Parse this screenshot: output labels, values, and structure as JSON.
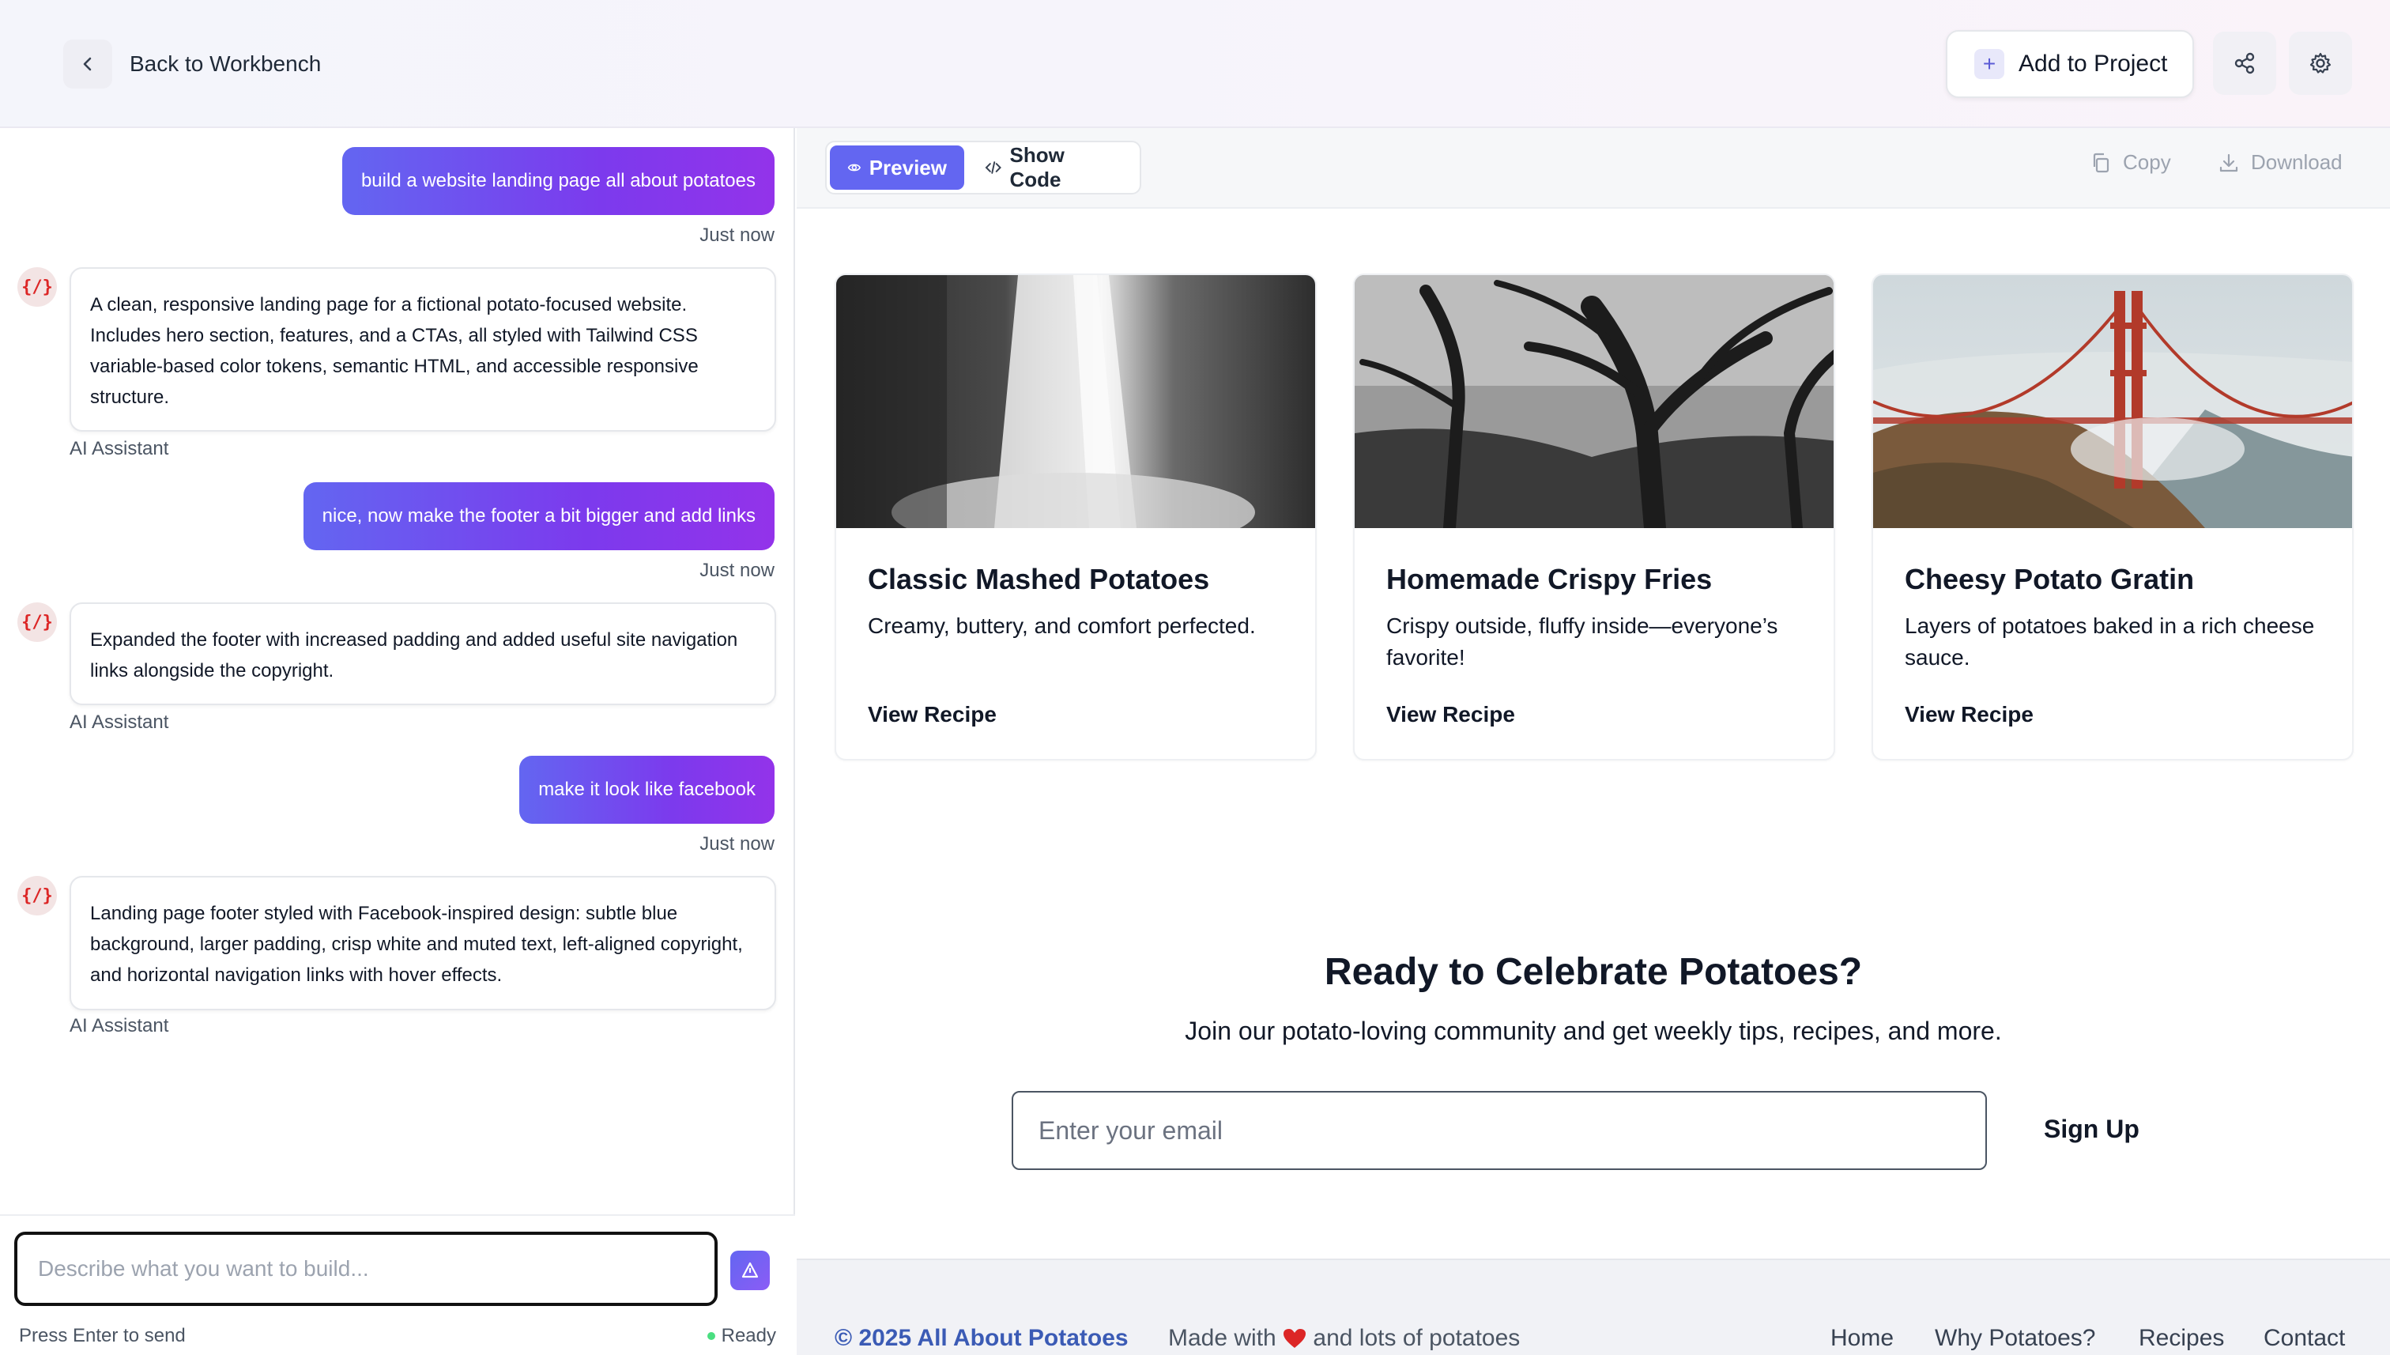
{
  "header": {
    "back_label": "Back to Workbench",
    "add_project_label": "Add to Project",
    "icons": [
      "chevron-left-icon",
      "plus-icon",
      "share-icon",
      "gear-icon"
    ]
  },
  "chat": {
    "messages": [
      {
        "role": "user",
        "text": "build a website landing page all about potatoes",
        "time": "Just now"
      },
      {
        "role": "assistant",
        "avatar": "{/}",
        "text": "A clean, responsive landing page for a fictional potato-focused website. Includes hero section, features, and a CTAs, all styled with Tailwind CSS variable-based color tokens, semantic HTML, and accessible responsive structure.",
        "name": "AI Assistant"
      },
      {
        "role": "user",
        "text": "nice, now make the footer a bit bigger and add links",
        "time": "Just now"
      },
      {
        "role": "assistant",
        "avatar": "{/}",
        "text": "Expanded the footer with increased padding and added useful site navigation links alongside the copyright.",
        "name": "AI Assistant"
      },
      {
        "role": "user",
        "text": "make it look like facebook",
        "time": "Just now"
      },
      {
        "role": "assistant",
        "avatar": "{/}",
        "text": "Landing page footer styled with Facebook-inspired design: subtle blue background, larger padding, crisp white and muted text, left-aligned copyright, and horizontal navigation links with hover effects.",
        "name": "AI Assistant"
      }
    ],
    "input_placeholder": "Describe what you want to build...",
    "hint": "Press Enter to send",
    "status": "Ready",
    "status_color": "#4ade80"
  },
  "toolbar": {
    "preview_label": "Preview",
    "code_label": "Show Code",
    "copy_label": "Copy",
    "download_label": "Download",
    "accent": "#6366f1"
  },
  "preview": {
    "cards": [
      {
        "title": "Classic Mashed Potatoes",
        "desc": "Creamy, buttery, and comfort perfected.",
        "link": "View Recipe",
        "image": "waterfall"
      },
      {
        "title": "Homemade Crispy Fries",
        "desc": "Crispy outside, fluffy inside—everyone’s favorite!",
        "link": "View Recipe",
        "image": "forest"
      },
      {
        "title": "Cheesy Potato Gratin",
        "desc": "Layers of potatoes baked in a rich cheese sauce.",
        "link": "View Recipe",
        "image": "bridge"
      }
    ],
    "cta_title": "Ready to Celebrate Potatoes?",
    "cta_sub": "Join our potato-loving community and get weekly tips, recipes, and more.",
    "email_placeholder": "Enter your email",
    "signup_label": "Sign Up",
    "footer": {
      "copyright": "© 2025 All About Potatoes",
      "made_prefix": "Made with",
      "made_suffix": "and lots of potatoes",
      "links": [
        "Home",
        "Why Potatoes?",
        "Recipes",
        "Contact"
      ],
      "brand_color": "#3b5bb5"
    }
  }
}
